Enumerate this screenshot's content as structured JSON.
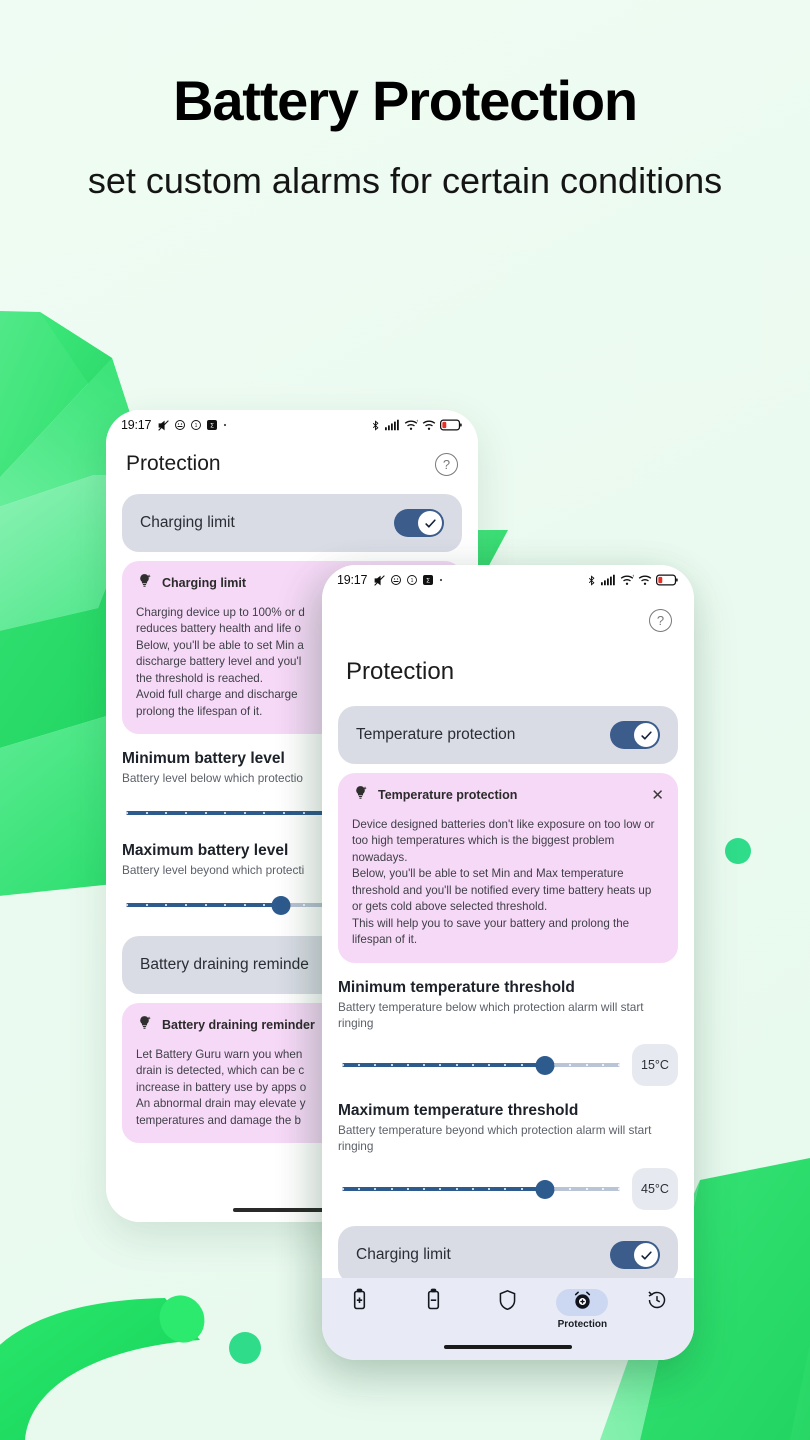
{
  "page": {
    "title": "Battery Protection",
    "subtitle": "set custom alarms for certain conditions",
    "background_color": "#effcf3",
    "accent_green": "#2fe06a",
    "accent_navy": "#2e5b8e",
    "card_purple": "#f6d9f7",
    "card_gray": "#d9dce5"
  },
  "status_bar": {
    "time": "19:17",
    "left_icons": [
      "mute-icon",
      "face-icon",
      "dnd-icon",
      "sigma-icon",
      "dot-icon"
    ],
    "right_icons": [
      "bluetooth-icon",
      "cellular-signal-icon",
      "wifi-plus-icon",
      "wifi-icon",
      "battery-low-icon"
    ]
  },
  "back_phone": {
    "app_title": "Protection",
    "help_icon": "help-circle-icon",
    "charging_limit_row": {
      "label": "Charging limit",
      "toggle_on": true
    },
    "charging_limit_info": {
      "icon": "lightbulb-icon",
      "title": "Charging limit",
      "body": "Charging device up to 100% or d\nreduces battery health and life o\nBelow, you'll be able to set Min a\ndischarge battery level and you'l\nthe threshold is reached.\nAvoid full charge and discharge\nprolong the lifespan of it."
    },
    "min_level": {
      "title": "Minimum battery level",
      "desc": "Battery level below which protectio",
      "thumb_percent": 72
    },
    "max_level": {
      "title": "Maximum battery level",
      "desc": "Battery level beyond which protecti",
      "thumb_percent": 46
    },
    "draining_row": {
      "label": "Battery draining reminde",
      "toggle_on": true
    },
    "draining_info": {
      "icon": "lightbulb-icon",
      "title": "Battery draining reminder",
      "body": "Let Battery Guru warn you when\ndrain is detected, which can be c\nincrease in battery use by apps o\nAn abnormal drain may elevate y\ntemperatures and damage the b"
    }
  },
  "front_phone": {
    "help_icon": "help-circle-icon",
    "app_title": "Protection",
    "temperature_row": {
      "label": "Temperature protection",
      "toggle_on": true
    },
    "temperature_info": {
      "icon": "lightbulb-icon",
      "title": "Temperature protection",
      "close_icon": "close-icon",
      "body": "Device designed batteries don't like exposure on too low or too high temperatures which is the biggest problem nowadays.\nBelow, you'll be able to set Min and Max temperature threshold and you'll be notified every time battery heats up or gets cold above selected threshold.\nThis will help you to save your battery and prolong the lifespan of it."
    },
    "min_threshold": {
      "title": "Minimum temperature threshold",
      "desc": "Battery temperature below which protection alarm will start ringing",
      "value": "15°C",
      "thumb_percent": 73
    },
    "max_threshold": {
      "title": "Maximum temperature threshold",
      "desc": "Battery temperature beyond which protection alarm will start ringing",
      "value": "45°C",
      "thumb_percent": 73
    },
    "charging_limit_row": {
      "label": "Charging limit",
      "toggle_on": true
    },
    "bottom_nav": [
      {
        "icon": "battery-plus-icon",
        "label": "",
        "active": false
      },
      {
        "icon": "battery-minus-icon",
        "label": "",
        "active": false
      },
      {
        "icon": "shield-icon",
        "label": "",
        "active": false
      },
      {
        "icon": "alarm-plus-icon",
        "label": "Protection",
        "active": true
      },
      {
        "icon": "history-clock-icon",
        "label": "",
        "active": false
      }
    ]
  }
}
